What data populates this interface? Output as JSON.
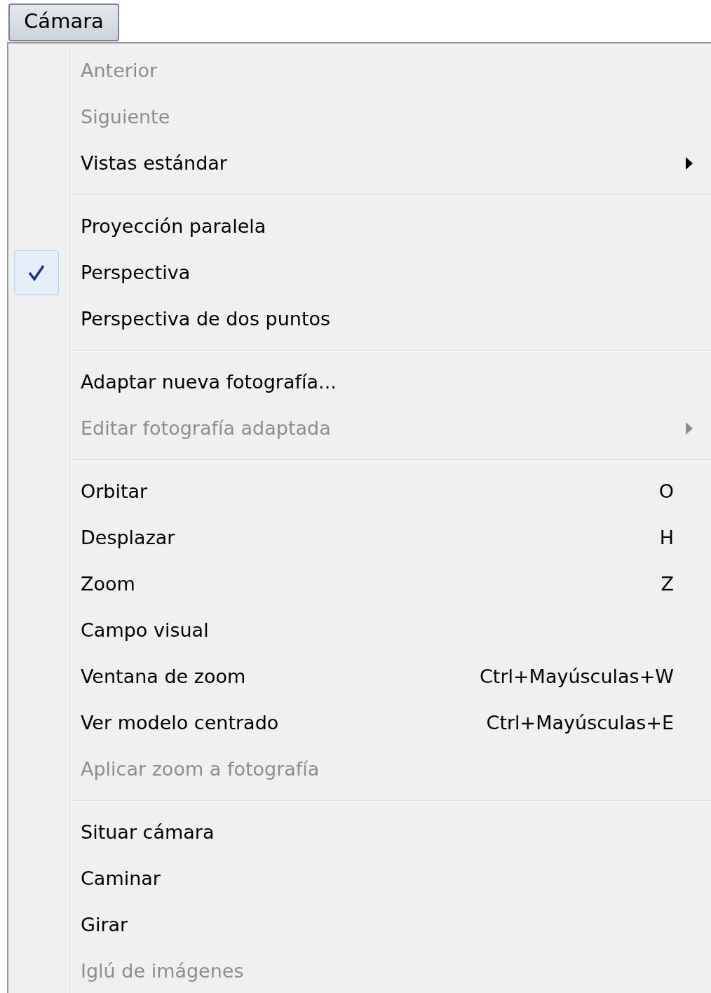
{
  "menu_button": {
    "label": "Cámara",
    "selected": true
  },
  "groups": [
    {
      "items": [
        {
          "label": "Anterior",
          "disabled": true,
          "checked": false,
          "submenu": false
        },
        {
          "label": "Siguiente",
          "disabled": true,
          "checked": false,
          "submenu": false
        },
        {
          "label": "Vistas estándar",
          "disabled": false,
          "checked": false,
          "submenu": true
        }
      ]
    },
    {
      "items": [
        {
          "label": "Proyección paralela",
          "disabled": false,
          "checked": false,
          "submenu": false
        },
        {
          "label": "Perspectiva",
          "disabled": false,
          "checked": true,
          "submenu": false
        },
        {
          "label": "Perspectiva de dos puntos",
          "disabled": false,
          "checked": false,
          "submenu": false
        }
      ]
    },
    {
      "items": [
        {
          "label": "Adaptar nueva fotografía...",
          "disabled": false,
          "checked": false,
          "submenu": false
        },
        {
          "label": "Editar fotografía adaptada",
          "disabled": true,
          "checked": false,
          "submenu": true
        }
      ]
    },
    {
      "items": [
        {
          "label": "Orbitar",
          "disabled": false,
          "checked": false,
          "submenu": false,
          "shortcut": "O"
        },
        {
          "label": "Desplazar",
          "disabled": false,
          "checked": false,
          "submenu": false,
          "shortcut": "H"
        },
        {
          "label": "Zoom",
          "disabled": false,
          "checked": false,
          "submenu": false,
          "shortcut": "Z"
        },
        {
          "label": "Campo visual",
          "disabled": false,
          "checked": false,
          "submenu": false
        },
        {
          "label": "Ventana de zoom",
          "disabled": false,
          "checked": false,
          "submenu": false,
          "shortcut": "Ctrl+Mayúsculas+W"
        },
        {
          "label": "Ver modelo centrado",
          "disabled": false,
          "checked": false,
          "submenu": false,
          "shortcut": "Ctrl+Mayúsculas+E"
        },
        {
          "label": "Aplicar zoom a fotografía",
          "disabled": true,
          "checked": false,
          "submenu": false
        }
      ]
    },
    {
      "items": [
        {
          "label": "Situar cámara",
          "disabled": false,
          "checked": false,
          "submenu": false
        },
        {
          "label": "Caminar",
          "disabled": false,
          "checked": false,
          "submenu": false
        },
        {
          "label": "Girar",
          "disabled": false,
          "checked": false,
          "submenu": false
        },
        {
          "label": "Iglú de imágenes",
          "disabled": true,
          "checked": false,
          "submenu": false
        }
      ]
    }
  ]
}
